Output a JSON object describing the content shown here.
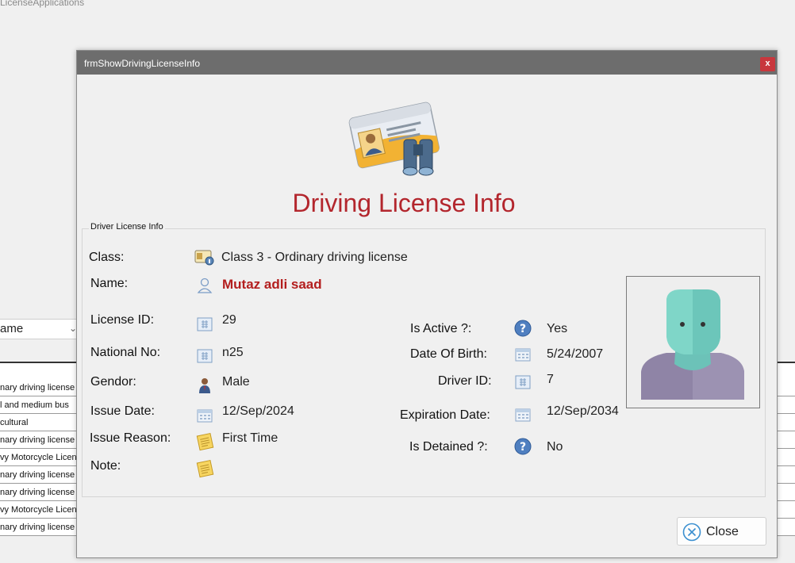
{
  "background": {
    "window_title": "LicenseApplications",
    "combo_value": "ame",
    "grid_rows": [
      "nary driving license",
      "l and medium bus",
      "cultural",
      "nary driving license",
      "vy Motorcycle License",
      "nary driving license",
      "nary driving license",
      "vy Motorcycle License",
      "nary driving license"
    ]
  },
  "dialog": {
    "title": "frmShowDrivingLicenseInfo",
    "close_x": "x",
    "heading": "Driving License Info",
    "group_title": "Driver License Info",
    "fields": {
      "class_label": "Class:",
      "class_value": "Class 3 - Ordinary driving license",
      "name_label": "Name:",
      "name_value": "Mutaz adli  saad",
      "license_id_label": "License ID:",
      "license_id_value": "29",
      "national_no_label": "National No:",
      "national_no_value": "n25",
      "gender_label": "Gendor:",
      "gender_value": "Male",
      "issue_date_label": "Issue Date:",
      "issue_date_value": "12/Sep/2024",
      "issue_reason_label": "Issue Reason:",
      "issue_reason_value": "First Time",
      "note_label": "Note:",
      "note_value": "",
      "is_active_label": "Is Active ?:",
      "is_active_value": "Yes",
      "dob_label": "Date Of Birth:",
      "dob_value": "5/24/2007",
      "driver_id_label": "Driver ID:",
      "driver_id_value": "7",
      "expiration_label": "Expiration Date:",
      "expiration_value": "12/Sep/2034",
      "is_detained_label": "Is Detained ?:",
      "is_detained_value": "No"
    },
    "close_button": "Close"
  },
  "colors": {
    "heading": "#b3262d",
    "name_value": "#b31e1e",
    "titlebar": "#6d6d6d",
    "close_x_bg": "#c8373d"
  },
  "icons": [
    "license-card-icon",
    "class-icon",
    "person-icon",
    "id-card-icon",
    "gender-male-icon",
    "calendar-icon",
    "note-icon",
    "question-icon",
    "close-circle-icon",
    "avatar-placeholder"
  ]
}
